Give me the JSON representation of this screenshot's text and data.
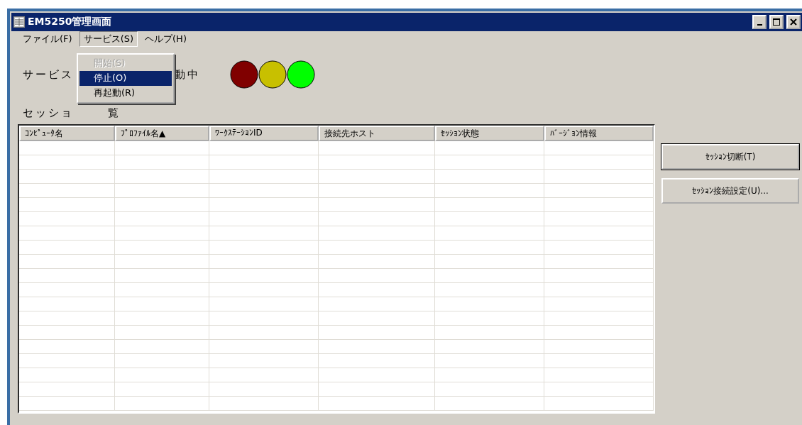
{
  "window": {
    "title": "EM5250管理画面"
  },
  "menu_bar": [
    {
      "label": "ファイル(F)",
      "selected": false
    },
    {
      "label": "サービス(S)",
      "selected": true
    },
    {
      "label": "ヘルプ(H)",
      "selected": false
    }
  ],
  "dropdown": [
    {
      "label": "開始(S)",
      "disabled": true,
      "selected": false
    },
    {
      "label": "停止(O)",
      "disabled": false,
      "selected": true
    },
    {
      "label": "再起動(R)",
      "disabled": false,
      "selected": false
    }
  ],
  "service_status": {
    "label": "サービス",
    "value": "動中",
    "lights": [
      {
        "color": "#800000"
      },
      {
        "color": "#c8c000"
      },
      {
        "color": "#00ff00"
      }
    ]
  },
  "session_list_label": [
    "セッショ",
    "覧"
  ],
  "table": {
    "columns": [
      "ｺﾝﾋﾟｭｰﾀ名",
      "ﾌﾟﾛﾌｧｲﾙ名▲",
      "ﾜｰｸｽﾃｰｼｮﾝID",
      "接続先ホスト",
      "ｾｯｼｮﾝ状態",
      "ﾊﾞｰｼﾞｮﾝ情報"
    ]
  },
  "buttons": [
    "ｾｯｼｮﾝ切断(T)",
    "ｾｯｼｮﾝ接続設定(U)..."
  ]
}
